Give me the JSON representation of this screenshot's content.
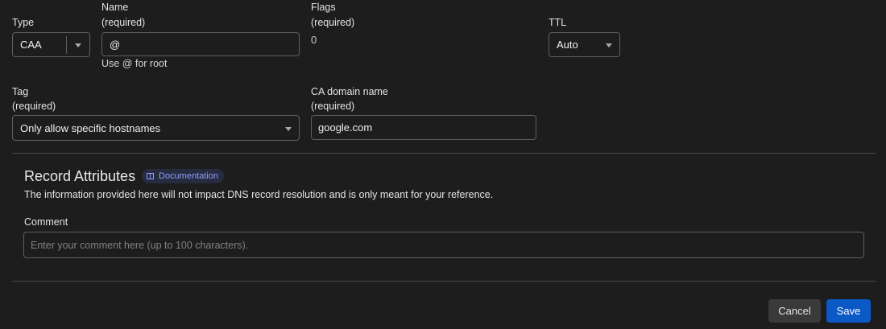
{
  "type_field": {
    "label": "Type",
    "value": "CAA"
  },
  "name_field": {
    "label_line1": "Name",
    "label_line2": "(required)",
    "value": "@",
    "help": "Use @ for root"
  },
  "flags_field": {
    "label_line1": "Flags",
    "label_line2": "(required)",
    "value": "0"
  },
  "ttl_field": {
    "label": "TTL",
    "value": "Auto"
  },
  "tag_field": {
    "label_line1": "Tag",
    "label_line2": "(required)",
    "value": "Only allow specific hostnames"
  },
  "ca_field": {
    "label_line1": "CA domain name",
    "label_line2": "(required)",
    "value": "google.com"
  },
  "record_attributes": {
    "title": "Record Attributes",
    "doc_label": "Documentation",
    "description": "The information provided here will not impact DNS record resolution and is only meant for your reference.",
    "comment_label": "Comment",
    "comment_placeholder": "Enter your comment here (up to 100 characters)."
  },
  "actions": {
    "cancel": "Cancel",
    "save": "Save"
  },
  "colors": {
    "accent": "#0b59c7",
    "link": "#8f9dff",
    "background": "#1d1d1d"
  },
  "icons": {
    "doc": "book-icon",
    "dropdown": "chevron-down-icon"
  }
}
